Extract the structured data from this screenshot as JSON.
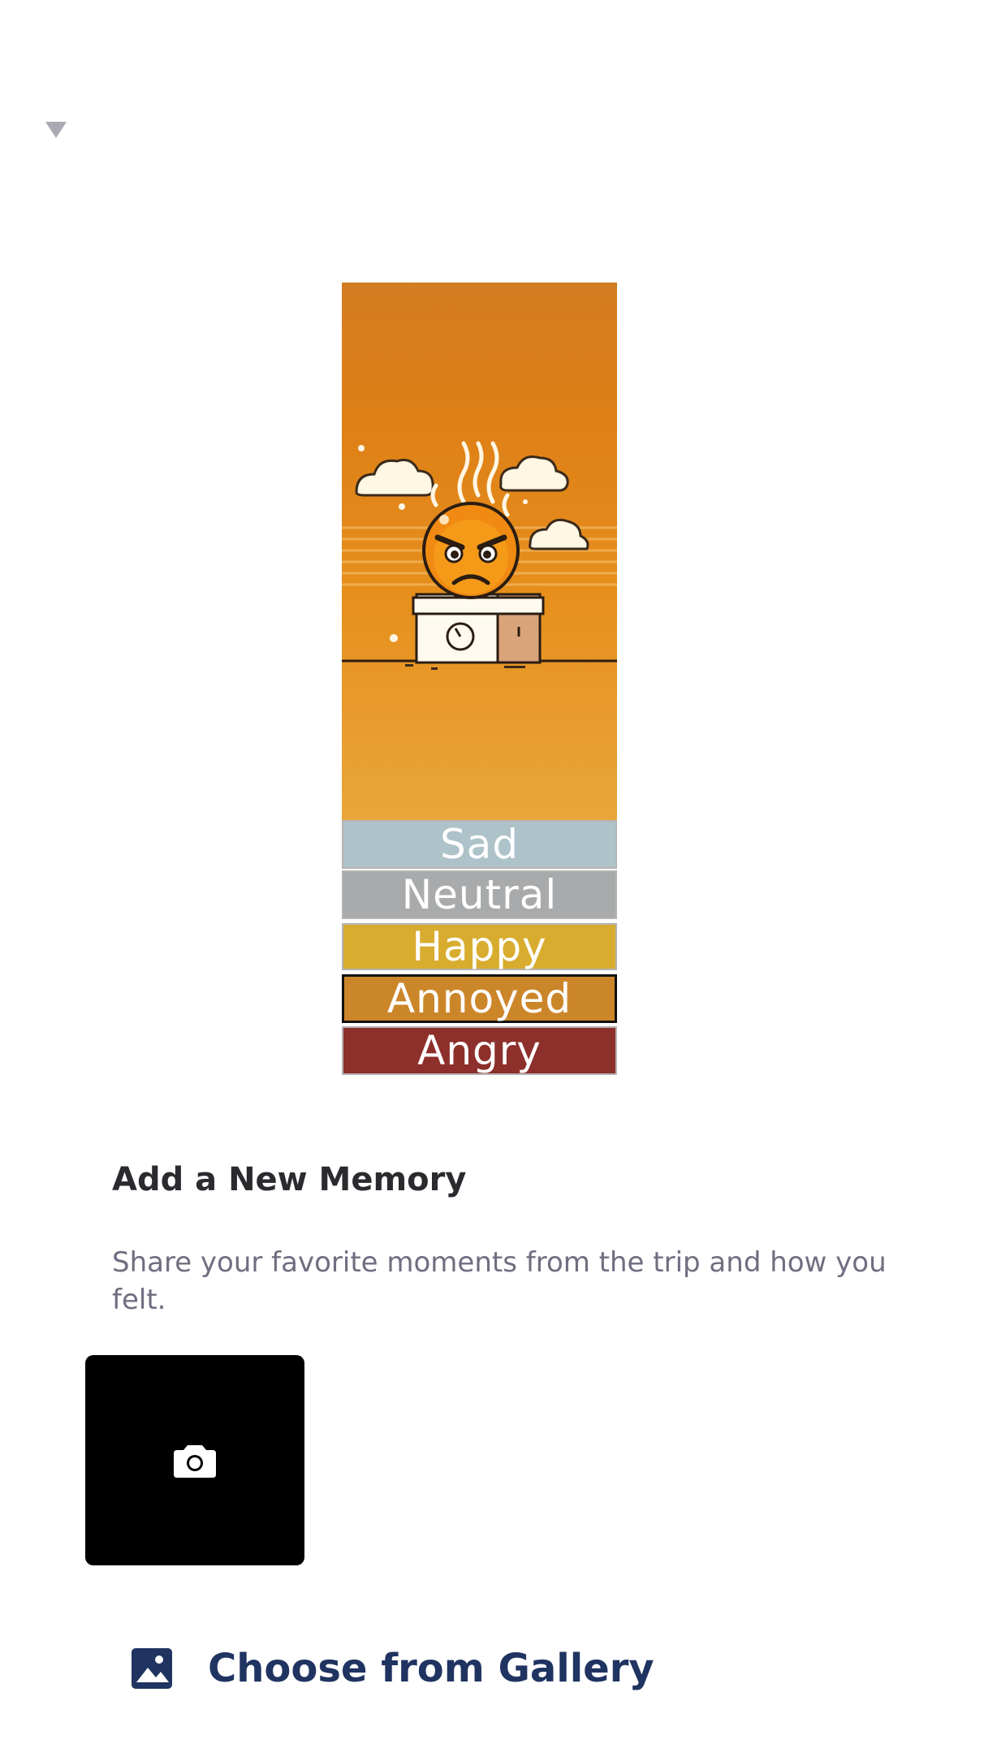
{
  "moods": {
    "options": [
      {
        "label": "Sad",
        "color": "#adc2c9",
        "selected": false
      },
      {
        "label": "Neutral",
        "color": "#a8aaab",
        "selected": false
      },
      {
        "label": "Happy",
        "color": "#d8ac2e",
        "selected": false
      },
      {
        "label": "Annoyed",
        "color": "#cc862a",
        "selected": true
      },
      {
        "label": "Angry",
        "color": "#8d2f2b",
        "selected": false
      }
    ]
  },
  "memory": {
    "title": "Add a New Memory",
    "subtitle": "Share your favorite moments from the trip and how you felt.",
    "camera_icon": "camera-icon",
    "gallery_icon": "image-icon",
    "gallery_label": "Choose from Gallery"
  }
}
